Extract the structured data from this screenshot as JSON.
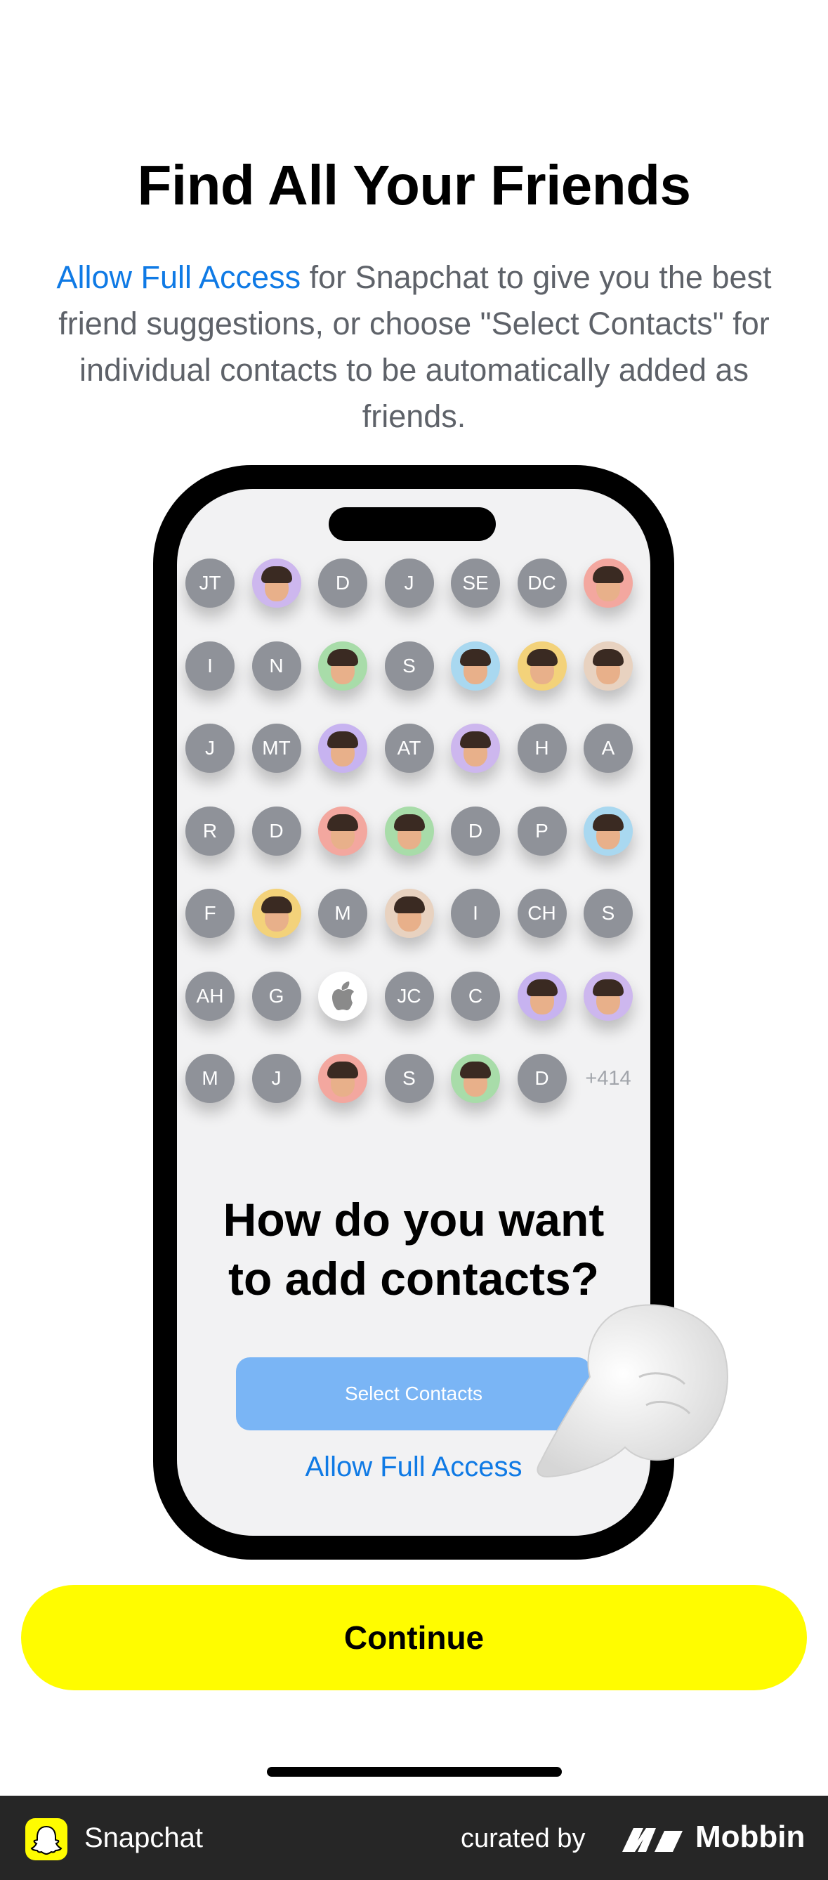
{
  "title": "Find All Your Friends",
  "subtitle": {
    "link": "Allow Full Access",
    "rest": " for Snapchat to give you the best friend suggestions, or choose \"Select Contacts\" for individual contacts to be automatically added as friends."
  },
  "illustration": {
    "avatar_rows": [
      [
        "JT",
        "",
        "D",
        "J",
        "SE",
        "DC",
        ""
      ],
      [
        "I",
        "N",
        "",
        "S",
        "",
        "",
        ""
      ],
      [
        "J",
        "MT",
        "",
        "AT",
        "",
        "H",
        "A"
      ],
      [
        "R",
        "D",
        "",
        "",
        "D",
        "P",
        ""
      ],
      [
        "F",
        "",
        "M",
        "",
        "I",
        "CH",
        "S"
      ],
      [
        "AH",
        "G",
        "",
        "JC",
        "C",
        "",
        ""
      ],
      [
        "M",
        "J",
        "",
        "S",
        "",
        "D",
        "+414"
      ]
    ],
    "prompt_line1": "How do you want",
    "prompt_line2": "to add contacts?",
    "select_button": "Select Contacts",
    "allow_button": "Allow Full Access"
  },
  "continue_label": "Continue",
  "footer": {
    "app_name": "Snapchat",
    "curated_by": "curated by",
    "brand": "Mobbin"
  },
  "colors": {
    "accent_blue": "#0f7ae5",
    "snap_yellow": "#fffc00",
    "button_blue": "#7ab5f5"
  }
}
